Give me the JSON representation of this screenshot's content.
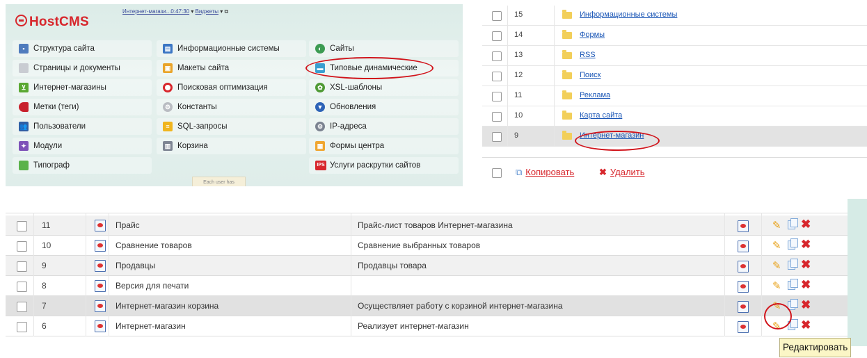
{
  "colors": {
    "accent_red": "#d7262c",
    "link_blue": "#1a56b6",
    "panel_bg": "#dcece8",
    "tooltip_bg": "#fbf6c6"
  },
  "start_menu": {
    "logo": "HostCMS",
    "topbar": {
      "site": "Интернет-магази...0:47:30",
      "widgets": "Виджеты"
    },
    "items": [
      {
        "label": "Структура сайта",
        "icon": "structure-icon"
      },
      {
        "label": "Информационные системы",
        "icon": "infosystems-icon"
      },
      {
        "label": "Сайты",
        "icon": "sites-icon"
      },
      {
        "label": "Страницы и документы",
        "icon": "documents-icon"
      },
      {
        "label": "Макеты сайта",
        "icon": "layouts-icon"
      },
      {
        "label": "Типовые динамические",
        "icon": "dynamic-pages-icon"
      },
      {
        "label": "Интернет-магазины",
        "icon": "shop-cart-icon"
      },
      {
        "label": "Поисковая оптимизация",
        "icon": "seo-icon"
      },
      {
        "label": "XSL-шаблоны",
        "icon": "xsl-icon"
      },
      {
        "label": "Метки (теги)",
        "icon": "tag-icon"
      },
      {
        "label": "Константы",
        "icon": "constants-icon"
      },
      {
        "label": "Обновления",
        "icon": "updates-icon"
      },
      {
        "label": "Пользователи",
        "icon": "users-icon"
      },
      {
        "label": "SQL-запросы",
        "icon": "sql-icon"
      },
      {
        "label": "IP-адреса",
        "icon": "ip-icon"
      },
      {
        "label": "Модули",
        "icon": "modules-icon"
      },
      {
        "label": "Корзина",
        "icon": "trash-icon"
      },
      {
        "label": "Формы центра",
        "icon": "forms-icon"
      },
      {
        "label": "Типограф",
        "icon": "typograph-icon"
      },
      {
        "label": "Услуги раскрутки сайтов",
        "icon": "promo-icon"
      }
    ],
    "ips_badge": "IPS",
    "note": "Each user has"
  },
  "types_list": {
    "rows": [
      {
        "id": "15",
        "name": "Информационные системы"
      },
      {
        "id": "14",
        "name": "Формы"
      },
      {
        "id": "13",
        "name": "RSS"
      },
      {
        "id": "12",
        "name": "Поиск"
      },
      {
        "id": "11",
        "name": "Реклама"
      },
      {
        "id": "10",
        "name": "Карта сайта"
      },
      {
        "id": "9",
        "name": "Интернет-магазин"
      }
    ],
    "copy_label": "Копировать",
    "delete_label": "Удалить"
  },
  "xsl_table": {
    "rows": [
      {
        "id": "11",
        "name": "Прайс",
        "description": "Прайс-лист товаров Интернет-магазина"
      },
      {
        "id": "10",
        "name": "Сравнение товаров",
        "description": "Сравнение выбранных товаров"
      },
      {
        "id": "9",
        "name": "Продавцы",
        "description": "Продавцы товара"
      },
      {
        "id": "8",
        "name": "Версия для печати",
        "description": ""
      },
      {
        "id": "7",
        "name": "Интернет-магазин корзина",
        "description": "Осуществляет работу с корзиной интернет-магазина"
      },
      {
        "id": "6",
        "name": "Интернет-магазин",
        "description": "Реализует интернет-магазин"
      }
    ],
    "tooltip": "Редактировать"
  }
}
